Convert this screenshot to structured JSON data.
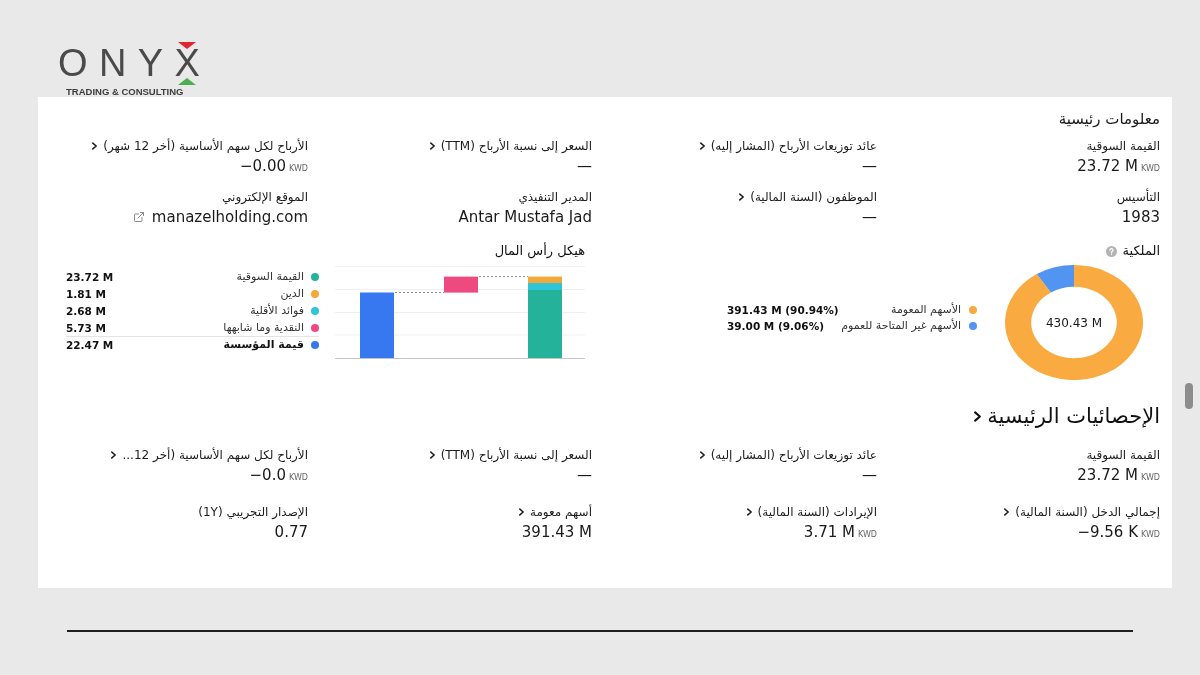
{
  "logo": {
    "wordmark": "ONYX",
    "tagline": "TRADING & CONSULTING"
  },
  "key_info": {
    "title": "معلومات رئيسية",
    "title_chevron": false,
    "fields": [
      {
        "label": "القيمة السوقية",
        "chevron": false,
        "kind": "value",
        "value": "23.72 M",
        "unit": "KWD"
      },
      {
        "label": "عائد توزيعات الأرباح (المشار إليه)",
        "chevron": true,
        "kind": "value",
        "value": "—"
      },
      {
        "label": "السعر إلى نسبة الأرباح (TTM)",
        "chevron": true,
        "kind": "value",
        "value": "—"
      },
      {
        "label": "الأرباح لكل سهم الأساسية (أخر 12 شهر)",
        "chevron": true,
        "kind": "value",
        "value": "−0.00",
        "unit": "KWD"
      },
      {
        "label": "التأسيس",
        "chevron": false,
        "kind": "value",
        "value": "1983"
      },
      {
        "label": "الموظفون (السنة المالية)",
        "chevron": true,
        "kind": "value",
        "value": "—"
      },
      {
        "label": "المدير التنفيذي",
        "chevron": false,
        "kind": "value",
        "value": "Antar Mustafa Jad"
      },
      {
        "label": "الموقع الإلكتروني",
        "chevron": false,
        "kind": "link",
        "value": "manazelholding.com"
      }
    ]
  },
  "capital_structure": {
    "title": "هيكل رأس المال",
    "legend": [
      {
        "label": "القيمة السوقية",
        "value": "23.72 M",
        "color": "#24b39a",
        "total": false
      },
      {
        "label": "الدين",
        "value": "1.81 M",
        "color": "#f5a83a",
        "total": false
      },
      {
        "label": "فوائد الأقلية",
        "value": "2.68 M",
        "color": "#30c5d6",
        "total": false
      },
      {
        "label": "النقدية وما شابهها",
        "value": "5.73 M",
        "color": "#ef4a80",
        "total": false
      },
      {
        "label": "قيمة المؤسسة",
        "value": "22.47 M",
        "color": "#3778f0",
        "total": true
      }
    ]
  },
  "ownership": {
    "title": "الملكية",
    "center_label": "430.43 M",
    "chart_data": {
      "type": "donut",
      "categories": [
        "الأسهم المعومة",
        "الأسهم غير المتاحة للعموم"
      ],
      "values": [
        90.94,
        9.06
      ]
    },
    "legend": [
      {
        "value": "391.43 M (90.94%)",
        "color": "#f9aa40"
      },
      {
        "value": "39.00 M (9.06%)",
        "color": "#5294f2"
      }
    ]
  },
  "key_stats": {
    "title": "الإحصائيات الرئيسية",
    "title_chevron": true,
    "fields": [
      {
        "label": "القيمة السوقية",
        "chevron": false,
        "kind": "value",
        "value": "23.72 M",
        "unit": "KWD"
      },
      {
        "label": "عائد توزيعات الأرباح (المشار إليه)",
        "chevron": true,
        "kind": "value",
        "value": "—"
      },
      {
        "label": "السعر إلى نسبة الأرباح (TTM)",
        "chevron": true,
        "kind": "value",
        "value": "—"
      },
      {
        "label": "الأرباح لكل سهم الأساسية (أخر 12...",
        "chevron": true,
        "kind": "value",
        "value": "−0.0",
        "unit": "KWD"
      },
      {
        "label": "إجمالي الدخل (السنة المالية)",
        "chevron": true,
        "kind": "value",
        "value": "−9.56 K",
        "unit": "KWD"
      },
      {
        "label": "الإيرادات (السنة المالية)",
        "chevron": true,
        "kind": "value",
        "value": "3.71 M",
        "unit": "KWD"
      },
      {
        "label": "أسهم معومة",
        "chevron": true,
        "kind": "value",
        "value": "391.43 M"
      },
      {
        "label": "الإصدار التجريبي (1Y)",
        "chevron": false,
        "kind": "value",
        "value": "0.77"
      }
    ]
  }
}
